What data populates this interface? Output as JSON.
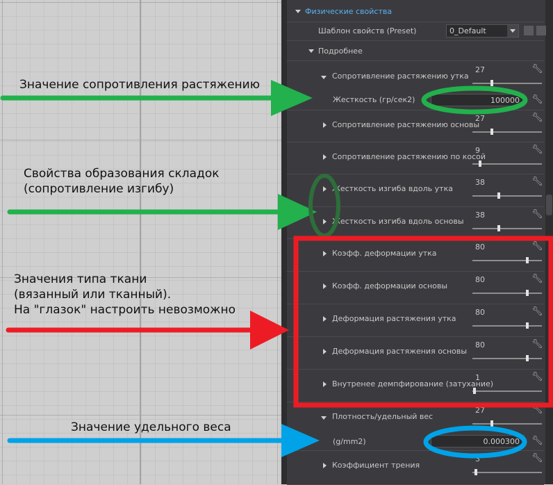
{
  "panel": {
    "section_title": "Физические свойства",
    "preset_label": "Шаблон свойств (Preset)",
    "preset_value": "0_Default",
    "details_label": "Подробнее"
  },
  "properties": [
    {
      "label": "Сопротивление растяжению утка",
      "value": "27",
      "slider": 0.27,
      "expanded": true
    },
    {
      "label": "Сопротивление растяжению основы",
      "value": "27",
      "slider": 0.27,
      "expanded": false
    },
    {
      "label": "Сопротивление растяжению по косой",
      "value": "9",
      "slider": 0.09,
      "expanded": false
    },
    {
      "label": "Жесткость изгиба вдоль утка",
      "value": "38",
      "slider": 0.38,
      "expanded": false
    },
    {
      "label": "Жесткость изгиба вдоль основы",
      "value": "38",
      "slider": 0.38,
      "expanded": false
    },
    {
      "label": "Коэфф. деформации утка",
      "value": "80",
      "slider": 0.8,
      "expanded": false
    },
    {
      "label": "Коэфф. деформации основы",
      "value": "80",
      "slider": 0.8,
      "expanded": false
    },
    {
      "label": "Деформация растяжения утка",
      "value": "80",
      "slider": 0.8,
      "expanded": false
    },
    {
      "label": "Деформация растяжения основы",
      "value": "80",
      "slider": 0.8,
      "expanded": false
    },
    {
      "label": "Внутренее демпфирование (затухание)",
      "value": "1",
      "slider": 0.01,
      "expanded": false
    },
    {
      "label": "Плотность/удельный вес",
      "value": "27",
      "slider": 0.27,
      "expanded": true
    },
    {
      "label": "Коэффициент трения",
      "value": "3",
      "slider": 0.03,
      "expanded": false
    }
  ],
  "subfields": {
    "stiffness_label": "Жесткость (гр/сек2)",
    "stiffness_value": "100000",
    "density_label": "(g/mm2)",
    "density_value": "0.000300"
  },
  "annotations": {
    "stretch": "Значение сопротивления  растяжению",
    "fold_1": "Свойства образования складок",
    "fold_2": "(сопротивление изгибу)",
    "fabric_1": "Значения типа ткани",
    "fabric_2": "(вязанный или тканный).",
    "fabric_3": "На \"глазок\" настроить невозможно",
    "weight": "Значение удельного веса"
  },
  "colors": {
    "green": "#22b14c",
    "dark_green": "#2d6e3a",
    "red": "#ed1c24",
    "blue": "#00a2e8"
  }
}
